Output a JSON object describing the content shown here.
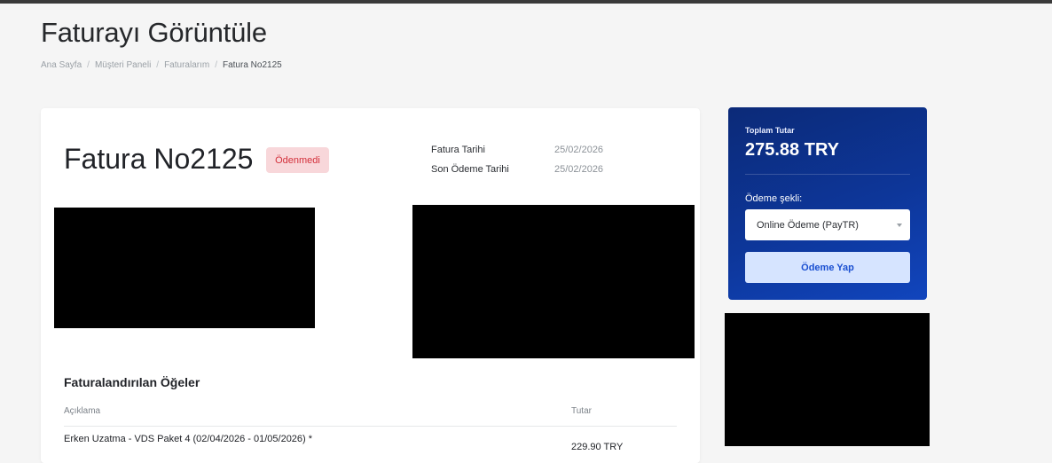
{
  "header": {
    "title": "Faturayı Görüntüle",
    "breadcrumb": [
      "Ana Sayfa",
      "Müşteri Paneli",
      "Faturalarım",
      "Fatura No2125"
    ]
  },
  "invoice": {
    "title": "Fatura No2125",
    "status": "Ödenmedi",
    "invoice_date_label": "Fatura Tarihi",
    "invoice_date": "25/02/2026",
    "due_date_label": "Son Ödeme Tarihi",
    "due_date": "25/02/2026"
  },
  "items": {
    "heading": "Faturalandırılan Öğeler",
    "columns": [
      "Açıklama",
      "Tutar"
    ],
    "rows": [
      {
        "description": "Erken Uzatma - VDS Paket 4 (02/04/2026 - 01/05/2026) *",
        "amount": "229.90 TRY"
      }
    ]
  },
  "summary": {
    "total_label": "Toplam Tutar",
    "total": "275.88 TRY",
    "payment_method_label": "Ödeme şekli:",
    "payment_method": "Online Ödeme (PayTR)",
    "pay_button": "Ödeme Yap"
  },
  "colors": {
    "accent": "#0d3699",
    "status_unpaid_bg": "#f8d7da",
    "status_unpaid_text": "#d32f3a",
    "background": "#f5f5f5"
  }
}
